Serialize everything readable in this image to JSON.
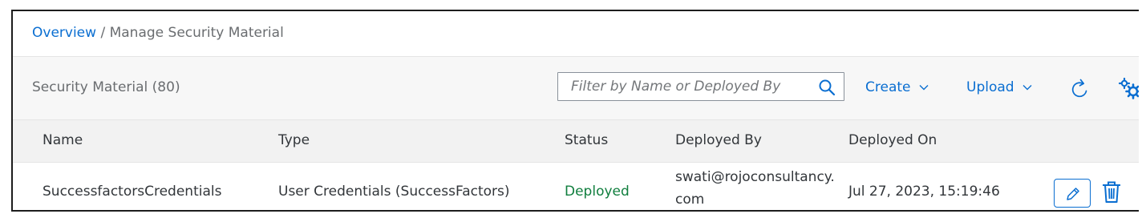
{
  "breadcrumb": {
    "link": "Overview",
    "separator": "/",
    "current": "Manage Security Material"
  },
  "toolbar": {
    "title": "Security Material (80)",
    "search_placeholder": "Filter by Name or Deployed By",
    "search_value": "",
    "create_label": "Create",
    "upload_label": "Upload",
    "icons": [
      "search-icon",
      "chevron-down-icon",
      "refresh-icon",
      "settings-icon"
    ]
  },
  "table": {
    "columns": [
      "Name",
      "Type",
      "Status",
      "Deployed By",
      "Deployed On"
    ],
    "rows": [
      {
        "name": "SuccessfactorsCredentials",
        "type": "User Credentials (SuccessFactors)",
        "status": "Deployed",
        "deployed_by": "swati@rojoconsultancy.com",
        "deployed_on": "Jul 27, 2023, 15:19:46",
        "actions": [
          "edit-icon",
          "delete-icon"
        ]
      }
    ]
  },
  "colors": {
    "accent": "#0a6ed1",
    "status_positive": "#107e3e",
    "text": "#32363a",
    "muted_text": "#6a6d70",
    "toolbar_bg": "#f7f7f7",
    "header_bg": "#f2f2f2"
  }
}
